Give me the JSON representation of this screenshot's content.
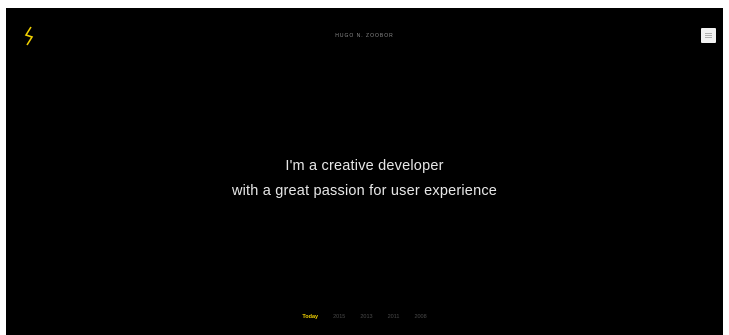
{
  "header": {
    "site_name": "HUGO N. ZOOBOR",
    "logo_icon": "lightning-bolt-icon",
    "menu_icon": "menu-icon",
    "accent_color": "#f0d000"
  },
  "hero": {
    "line1": "I'm a creative developer",
    "line2": "with a great passion for user experience"
  },
  "timeline": {
    "items": [
      "Today",
      "2015",
      "2013",
      "2011",
      "2008"
    ],
    "active_index": 0
  }
}
